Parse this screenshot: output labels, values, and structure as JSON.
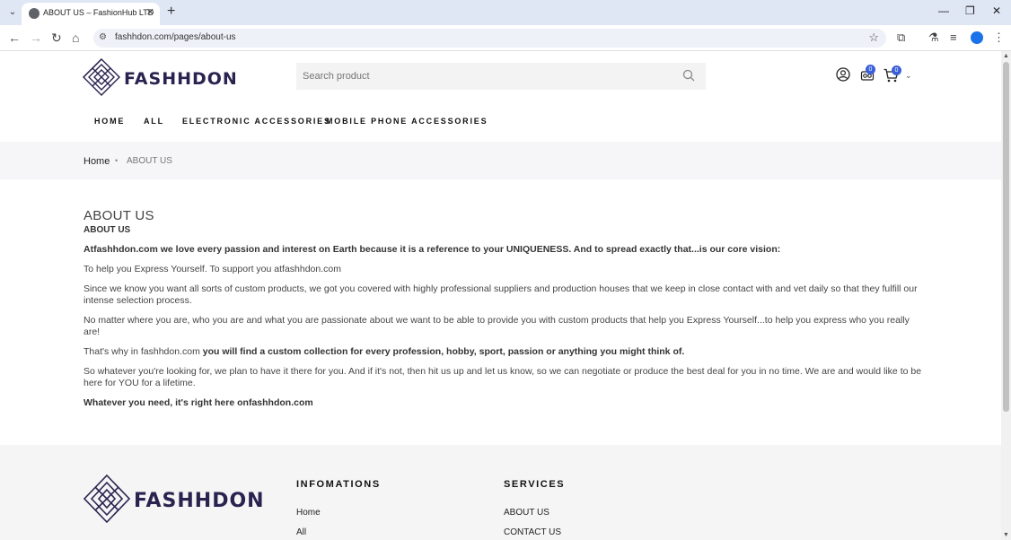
{
  "browser": {
    "tab_title": "ABOUT US – FashionHub LTD",
    "url": "fashhdon.com/pages/about-us"
  },
  "header": {
    "search_placeholder": "Search product",
    "wishlist_count": "0",
    "cart_count": "0"
  },
  "nav": {
    "items": [
      {
        "label": "HOME"
      },
      {
        "label": "ALL"
      },
      {
        "label": "ELECTRONIC ACCESSORIES"
      },
      {
        "label": "MOBILE PHONE ACCESSORIES"
      }
    ]
  },
  "breadcrumb": {
    "home": "Home",
    "current": "ABOUT US"
  },
  "content": {
    "title": "ABOUT US",
    "subtitle": "ABOUT US",
    "p1": "Atfashhdon.com  we love every passion and interest on Earth because it is a reference to your UNIQUENESS. And to spread exactly that...is our core vision:",
    "p2": "To help you Express Yourself. To support you atfashhdon.com",
    "p3": "Since we know you want all sorts of custom products, we got you covered with highly professional suppliers and production houses that we keep in close contact with and vet daily so that they fulfill our intense selection process.",
    "p4": "No matter where you are, who you are and what you are passionate about we want to be able to provide you with custom products that help you Express Yourself...to help you express who you really are!",
    "p5_prefix": "That's why in fashhdon.com ",
    "p5_bold": " you will find a custom collection for every profession, hobby, sport, passion or anything you might think of.",
    "p6": "So whatever you're looking for, we plan to have it there for you. And if it's not, then hit us up and let us know, so we can negotiate or produce the best deal for you in no time. We are and would like to be here for YOU for a lifetime.",
    "p7": "Whatever you need, it's right here onfashhdon.com"
  },
  "footer": {
    "col1_title": "INFOMATIONS",
    "col1_links": [
      "Home",
      "All"
    ],
    "col2_title": "SERVICES",
    "col2_links": [
      "ABOUT US",
      "CONTACT US"
    ]
  },
  "colors": {
    "accent": "#3a5fd9",
    "logo": "#2a2350"
  }
}
